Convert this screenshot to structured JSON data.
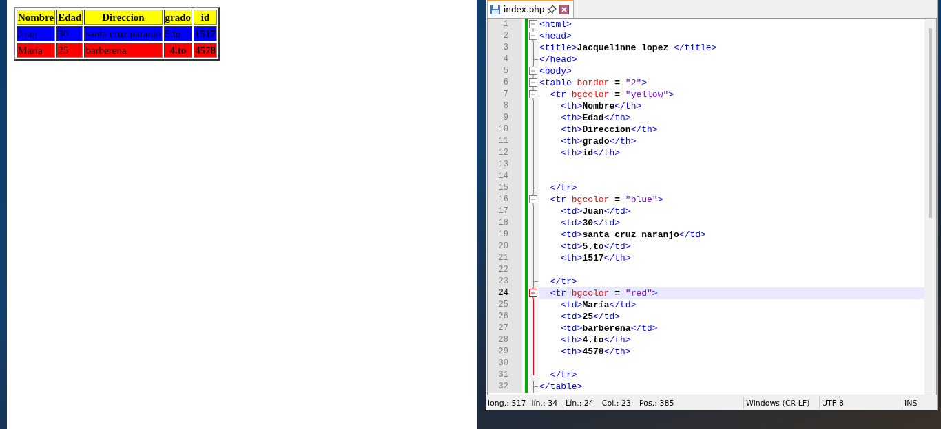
{
  "browser": {
    "table": {
      "header": {
        "color": "#ffff00",
        "cells": [
          "Nombre",
          "Edad",
          "Direccion",
          "grado",
          "id"
        ]
      },
      "rows": [
        {
          "color": "#0000ff",
          "cells": [
            {
              "text": "Juan",
              "header": false
            },
            {
              "text": "30",
              "header": false
            },
            {
              "text": "santa cruz naranjo",
              "header": false
            },
            {
              "text": "5.to",
              "header": false
            },
            {
              "text": "1517",
              "header": true
            }
          ]
        },
        {
          "color": "#ff0000",
          "cells": [
            {
              "text": "María",
              "header": false
            },
            {
              "text": "25",
              "header": false
            },
            {
              "text": "barberena",
              "header": false
            },
            {
              "text": "4.to",
              "header": true
            },
            {
              "text": "4578",
              "header": true
            }
          ]
        }
      ]
    }
  },
  "editor": {
    "tabs": [
      {
        "label": "index.php",
        "selected": true
      }
    ],
    "lines": [
      {
        "number": "1",
        "kind": "box",
        "active": false,
        "selected": false,
        "tokens": [
          {
            "kind": "tag",
            "text": "<html>"
          }
        ]
      },
      {
        "number": "2",
        "kind": "box",
        "active": false,
        "selected": false,
        "tokens": [
          {
            "kind": "tag",
            "text": "<head>"
          }
        ]
      },
      {
        "number": "3",
        "kind": "line",
        "active": false,
        "selected": false,
        "tokens": [
          {
            "kind": "tag",
            "text": "<title>"
          },
          {
            "kind": "text",
            "text": "Jacquelinne lopez "
          },
          {
            "kind": "tag",
            "text": "</title>"
          }
        ]
      },
      {
        "number": "4",
        "kind": "tee",
        "active": false,
        "selected": false,
        "tokens": [
          {
            "kind": "tag",
            "text": "</head>"
          }
        ]
      },
      {
        "number": "5",
        "kind": "box",
        "active": false,
        "selected": false,
        "tokens": [
          {
            "kind": "tag",
            "text": "<body>"
          }
        ]
      },
      {
        "number": "6",
        "kind": "box",
        "active": false,
        "selected": false,
        "tokens": [
          {
            "kind": "tag",
            "text": "<table"
          },
          {
            "kind": "attr",
            "text": " border"
          },
          {
            "kind": "op",
            "text": " = "
          },
          {
            "kind": "value",
            "text": "\"2\""
          },
          {
            "kind": "tag",
            "text": ">"
          }
        ]
      },
      {
        "number": "7",
        "kind": "box",
        "active": false,
        "selected": false,
        "tokens": [
          {
            "kind": "tag",
            "text": "  <tr"
          },
          {
            "kind": "attr",
            "text": " bgcolor"
          },
          {
            "kind": "op",
            "text": " = "
          },
          {
            "kind": "value",
            "text": "\"yellow\""
          },
          {
            "kind": "tag",
            "text": ">"
          }
        ]
      },
      {
        "number": "8",
        "kind": "line",
        "active": false,
        "selected": false,
        "tokens": [
          {
            "kind": "tag",
            "text": "    <th>"
          },
          {
            "kind": "text",
            "text": "Nombre"
          },
          {
            "kind": "tag",
            "text": "</th>"
          }
        ]
      },
      {
        "number": "9",
        "kind": "line",
        "active": false,
        "selected": false,
        "tokens": [
          {
            "kind": "tag",
            "text": "    <th>"
          },
          {
            "kind": "text",
            "text": "Edad"
          },
          {
            "kind": "tag",
            "text": "</th>"
          }
        ]
      },
      {
        "number": "10",
        "kind": "line",
        "active": false,
        "selected": false,
        "tokens": [
          {
            "kind": "tag",
            "text": "    <th>"
          },
          {
            "kind": "text",
            "text": "Direccion"
          },
          {
            "kind": "tag",
            "text": "</th>"
          }
        ]
      },
      {
        "number": "11",
        "kind": "line",
        "active": false,
        "selected": false,
        "tokens": [
          {
            "kind": "tag",
            "text": "    <th>"
          },
          {
            "kind": "text",
            "text": "grado"
          },
          {
            "kind": "tag",
            "text": "</th>"
          }
        ]
      },
      {
        "number": "12",
        "kind": "line",
        "active": false,
        "selected": false,
        "tokens": [
          {
            "kind": "tag",
            "text": "    <th>"
          },
          {
            "kind": "text",
            "text": "id"
          },
          {
            "kind": "tag",
            "text": "</th>"
          }
        ]
      },
      {
        "number": "13",
        "kind": "line",
        "active": false,
        "selected": false
      },
      {
        "number": "14",
        "kind": "line",
        "active": false,
        "selected": false
      },
      {
        "number": "15",
        "kind": "tee",
        "active": false,
        "selected": false,
        "tokens": [
          {
            "kind": "tag",
            "text": "  </tr>"
          }
        ]
      },
      {
        "number": "16",
        "kind": "box",
        "active": false,
        "selected": false,
        "tokens": [
          {
            "kind": "tag",
            "text": "  <tr"
          },
          {
            "kind": "attr",
            "text": " bgcolor"
          },
          {
            "kind": "op",
            "text": " = "
          },
          {
            "kind": "value",
            "text": "\"blue\""
          },
          {
            "kind": "tag",
            "text": ">"
          }
        ]
      },
      {
        "number": "17",
        "kind": "line",
        "active": false,
        "selected": false,
        "tokens": [
          {
            "kind": "tag",
            "text": "    <td>"
          },
          {
            "kind": "text",
            "text": "Juan"
          },
          {
            "kind": "tag",
            "text": "</td>"
          }
        ]
      },
      {
        "number": "18",
        "kind": "line",
        "active": false,
        "selected": false,
        "tokens": [
          {
            "kind": "tag",
            "text": "    <td>"
          },
          {
            "kind": "text",
            "text": "30"
          },
          {
            "kind": "tag",
            "text": "</td>"
          }
        ]
      },
      {
        "number": "19",
        "kind": "line",
        "active": false,
        "selected": false,
        "tokens": [
          {
            "kind": "tag",
            "text": "    <td>"
          },
          {
            "kind": "text",
            "text": "santa cruz naranjo"
          },
          {
            "kind": "tag",
            "text": "</td>"
          }
        ]
      },
      {
        "number": "20",
        "kind": "line",
        "active": false,
        "selected": false,
        "tokens": [
          {
            "kind": "tag",
            "text": "    <td>"
          },
          {
            "kind": "text",
            "text": "5.to"
          },
          {
            "kind": "tag",
            "text": "</td>"
          }
        ]
      },
      {
        "number": "21",
        "kind": "line",
        "active": false,
        "selected": false,
        "tokens": [
          {
            "kind": "tag",
            "text": "    <th>"
          },
          {
            "kind": "text",
            "text": "1517"
          },
          {
            "kind": "tag",
            "text": "</th>"
          }
        ]
      },
      {
        "number": "22",
        "kind": "line",
        "active": false,
        "selected": false
      },
      {
        "number": "23",
        "kind": "tee",
        "active": false,
        "selected": false,
        "tokens": [
          {
            "kind": "tag",
            "text": "  </tr>"
          }
        ]
      },
      {
        "number": "24",
        "kind": "box",
        "active": true,
        "selected": true,
        "tokens": [
          {
            "kind": "tag",
            "text": "  <tr"
          },
          {
            "kind": "attr",
            "text": " bgcolor"
          },
          {
            "kind": "op",
            "text": " = "
          },
          {
            "kind": "value",
            "text": "\"red\""
          },
          {
            "kind": "tag",
            "text": ">"
          }
        ]
      },
      {
        "number": "25",
        "kind": "line",
        "active": true,
        "selected": false,
        "tokens": [
          {
            "kind": "tag",
            "text": "    <td>"
          },
          {
            "kind": "text",
            "text": "María"
          },
          {
            "kind": "tag",
            "text": "</td>"
          }
        ]
      },
      {
        "number": "26",
        "kind": "line",
        "active": true,
        "selected": false,
        "tokens": [
          {
            "kind": "tag",
            "text": "    <td>"
          },
          {
            "kind": "text",
            "text": "25"
          },
          {
            "kind": "tag",
            "text": "</td>"
          }
        ]
      },
      {
        "number": "27",
        "kind": "line",
        "active": true,
        "selected": false,
        "tokens": [
          {
            "kind": "tag",
            "text": "    <td>"
          },
          {
            "kind": "text",
            "text": "barberena"
          },
          {
            "kind": "tag",
            "text": "</td>"
          }
        ]
      },
      {
        "number": "28",
        "kind": "line",
        "active": true,
        "selected": false,
        "tokens": [
          {
            "kind": "tag",
            "text": "    <th>"
          },
          {
            "kind": "text",
            "text": "4.to"
          },
          {
            "kind": "tag",
            "text": "</th>"
          }
        ]
      },
      {
        "number": "29",
        "kind": "line",
        "active": true,
        "selected": false,
        "tokens": [
          {
            "kind": "tag",
            "text": "    <th>"
          },
          {
            "kind": "text",
            "text": "4578"
          },
          {
            "kind": "tag",
            "text": "</th>"
          }
        ]
      },
      {
        "number": "30",
        "kind": "line",
        "active": true,
        "selected": false
      },
      {
        "number": "31",
        "kind": "end",
        "active": true,
        "selected": false,
        "tokens": [
          {
            "kind": "tag",
            "text": "  </tr>"
          }
        ]
      },
      {
        "number": "32",
        "kind": "tee",
        "active": false,
        "selected": false,
        "tokens": [
          {
            "kind": "tag",
            "text": "</table>"
          }
        ]
      }
    ],
    "status_bar": {
      "left": [
        "long.: 517",
        "lín.: 34"
      ],
      "middle": [
        "Lín.: 24",
        "Col.: 23",
        "Pos.: 385"
      ],
      "eol": "Windows (CR LF)",
      "encoding": "UTF-8",
      "mode": "INS"
    }
  }
}
